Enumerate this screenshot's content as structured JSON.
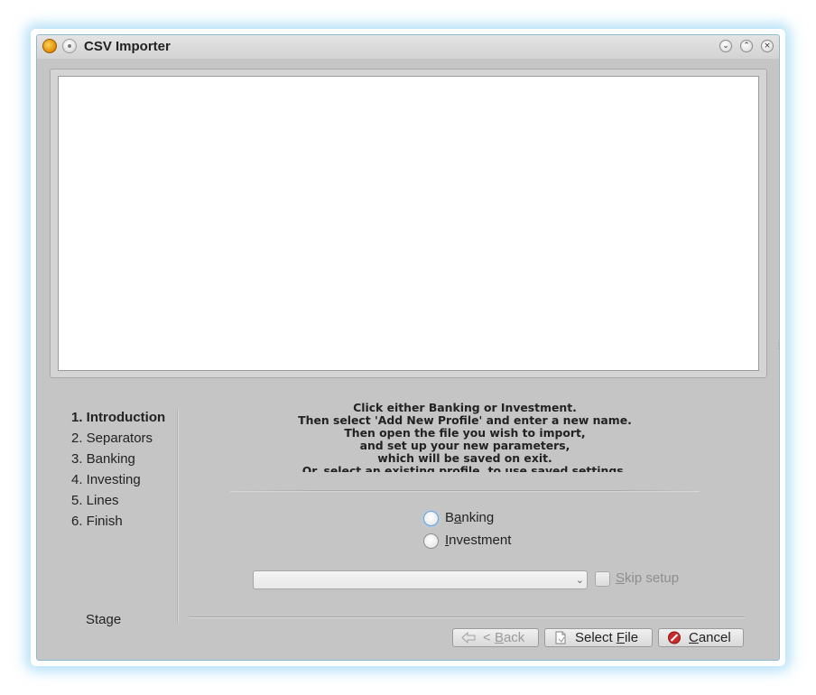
{
  "window": {
    "title": "CSV Importer",
    "controls": {
      "minimize": "⌄",
      "maximize": "⌃",
      "close": "×"
    }
  },
  "steps": [
    {
      "label": "1. Introduction",
      "active": true
    },
    {
      "label": "2. Separators",
      "active": false
    },
    {
      "label": "3. Banking",
      "active": false
    },
    {
      "label": "4. Investing",
      "active": false
    },
    {
      "label": "5. Lines",
      "active": false
    },
    {
      "label": "6. Finish",
      "active": false
    }
  ],
  "stage_label": "Stage",
  "intro": {
    "lines": [
      "Click either Banking or Investment.",
      "Then select 'Add New Profile' and enter a new name.",
      "Then open the file you wish to import,",
      "and set up your new parameters,",
      "which will be saved on exit.",
      "Or, select an existing profile, to use saved settings."
    ]
  },
  "options": {
    "banking": {
      "label_pre": "B",
      "label_mnemonic": "a",
      "label_post": "nking"
    },
    "investment": {
      "label_pre": "",
      "label_mnemonic": "I",
      "label_post": "nvestment"
    }
  },
  "profile_combo": {
    "value": ""
  },
  "skip_setup": {
    "label_mnemonic": "S",
    "label_post": "kip setup",
    "checked": false,
    "enabled": false
  },
  "buttons": {
    "back": {
      "label_pre": "< ",
      "label_mnemonic": "B",
      "label_post": "ack",
      "enabled": false
    },
    "select_file": {
      "label_pre": "Select ",
      "label_mnemonic": "F",
      "label_post": "ile"
    },
    "cancel": {
      "label_pre": "",
      "label_mnemonic": "C",
      "label_post": "ancel"
    }
  },
  "colors": {
    "window_bg": "#c5c5c5",
    "focus_ring": "#6a9fd6",
    "cancel_icon": "#cc2a2a",
    "glow": "#78c8f0"
  }
}
